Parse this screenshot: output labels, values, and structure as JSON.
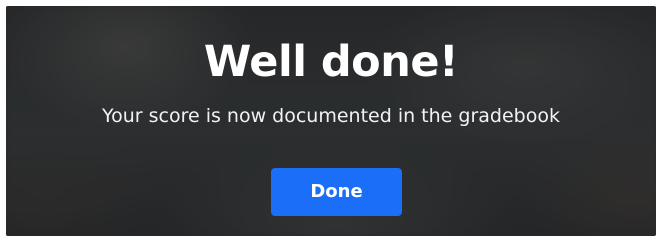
{
  "dialog": {
    "title": "Well done!",
    "message": "Your score is now documented in the gradebook",
    "done_label": "Done"
  },
  "colors": {
    "accent": "#1b6ef7",
    "text": "#ffffff",
    "backdrop": "#2f3233"
  }
}
